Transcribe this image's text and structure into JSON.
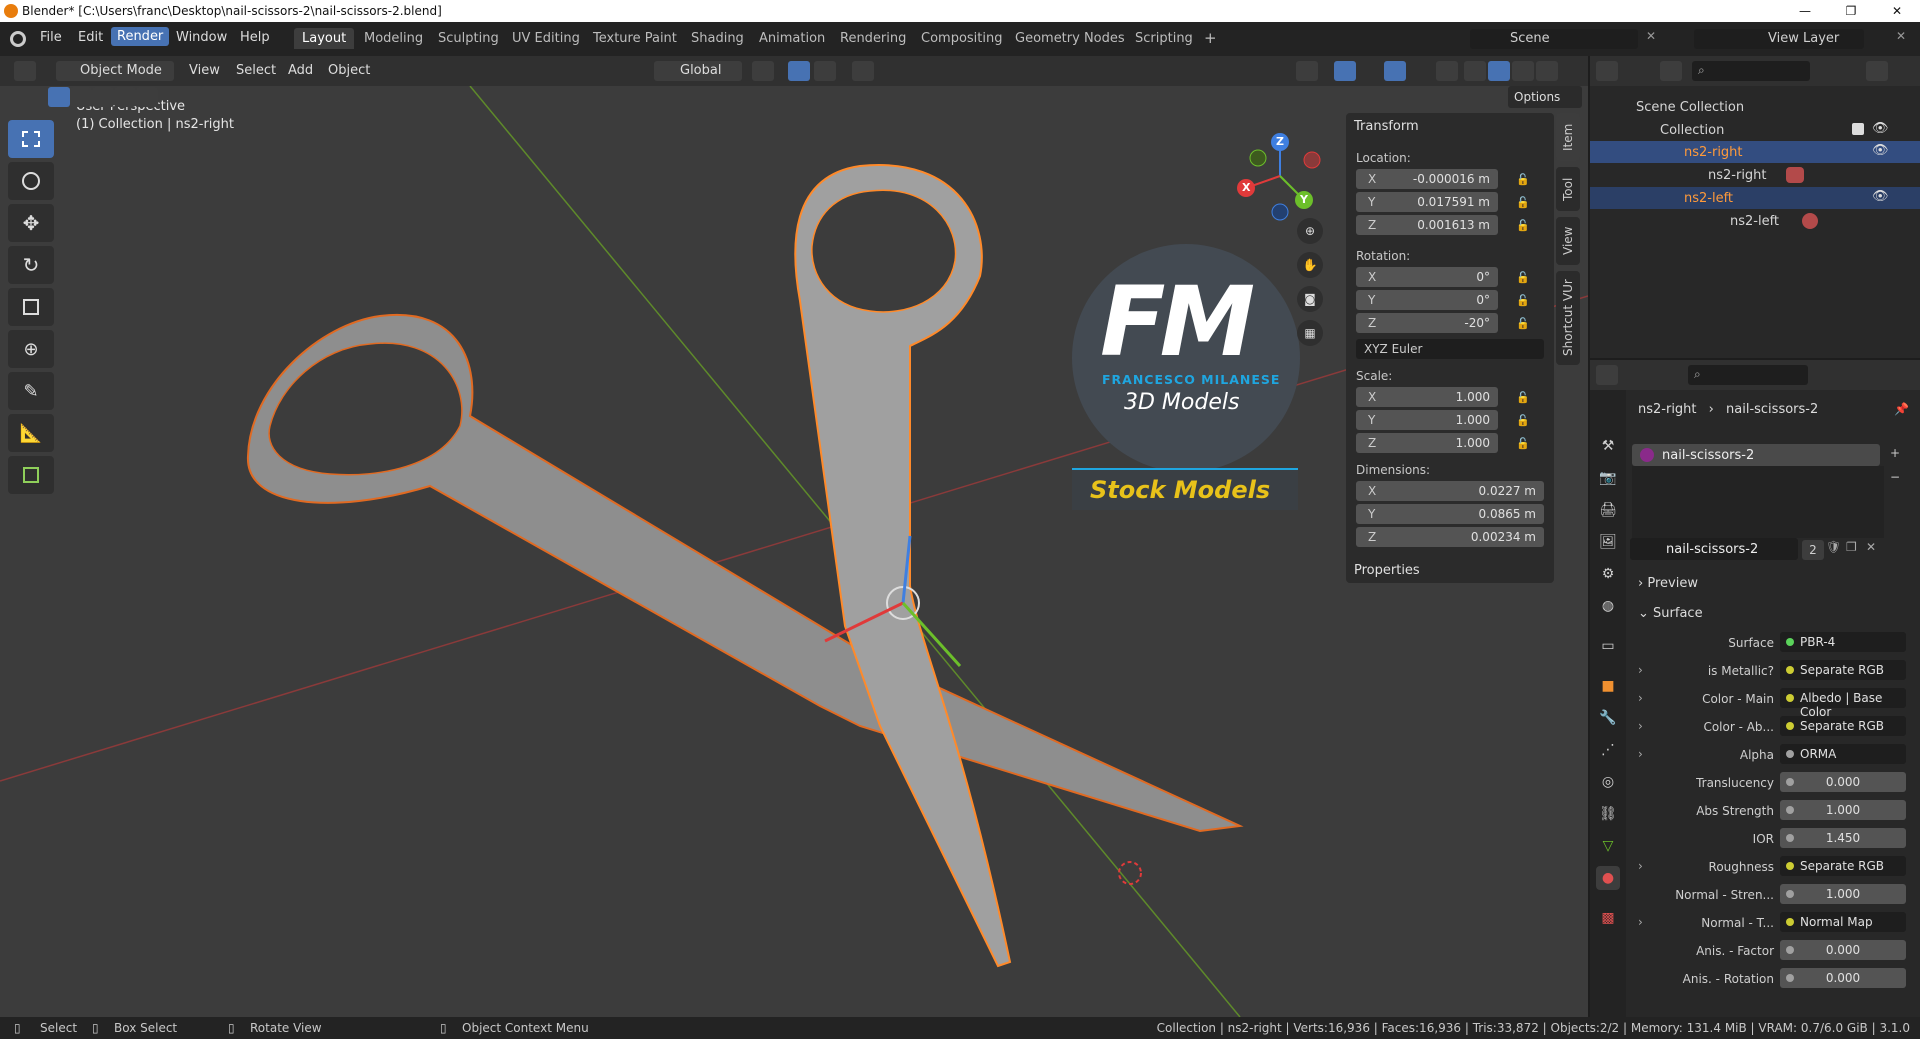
{
  "window": {
    "title": "Blender* [C:\\Users\\franc\\Desktop\\nail-scissors-2\\nail-scissors-2.blend]",
    "min": "—",
    "max": "❐",
    "close": "✕"
  },
  "menus": [
    "File",
    "Edit",
    "Render",
    "Window",
    "Help"
  ],
  "workspaces": [
    "Layout",
    "Modeling",
    "Sculpting",
    "UV Editing",
    "Texture Paint",
    "Shading",
    "Animation",
    "Rendering",
    "Compositing",
    "Geometry Nodes",
    "Scripting",
    "+"
  ],
  "scene": "Scene",
  "view_layer": "View Layer",
  "header": {
    "mode": "Object Mode",
    "view": "View",
    "select": "Select",
    "add": "Add",
    "object": "Object",
    "orientation": "Global",
    "options": "Options"
  },
  "viewport": {
    "perspective": "User Perspective",
    "collection_info": "(1) Collection | ns2-right"
  },
  "logo": {
    "initials": "FM",
    "name": "FRANCESCO MILANESE",
    "sub": "3D Models",
    "banner": "Stock Models"
  },
  "gizmo": {
    "x": "X",
    "y": "Y",
    "z": "Z"
  },
  "transform": {
    "title": "Transform",
    "location_label": "Location:",
    "location": [
      {
        "ax": "X",
        "v": "-0.000016 m"
      },
      {
        "ax": "Y",
        "v": "0.017591 m"
      },
      {
        "ax": "Z",
        "v": "0.001613 m"
      }
    ],
    "rotation_label": "Rotation:",
    "rotation": [
      {
        "ax": "X",
        "v": "0°"
      },
      {
        "ax": "Y",
        "v": "0°"
      },
      {
        "ax": "Z",
        "v": "-20°"
      }
    ],
    "rotation_mode": "XYZ Euler",
    "scale_label": "Scale:",
    "scale": [
      {
        "ax": "X",
        "v": "1.000"
      },
      {
        "ax": "Y",
        "v": "1.000"
      },
      {
        "ax": "Z",
        "v": "1.000"
      }
    ],
    "dimensions_label": "Dimensions:",
    "dimensions": [
      {
        "ax": "X",
        "v": "0.0227 m"
      },
      {
        "ax": "Y",
        "v": "0.0865 m"
      },
      {
        "ax": "Z",
        "v": "0.00234 m"
      }
    ],
    "properties": "Properties"
  },
  "sidetabs": [
    "Item",
    "Tool",
    "View",
    "Shortcut VUr"
  ],
  "outliner": {
    "scene_collection": "Scene Collection",
    "collection": "Collection",
    "items": [
      "ns2-right",
      "ns2-right",
      "ns2-left",
      "ns2-left"
    ]
  },
  "props": {
    "object": "ns2-right",
    "material_path": "nail-scissors-2",
    "slot": "nail-scissors-2",
    "material_name": "nail-scissors-2",
    "users": "2",
    "preview": "Preview",
    "surface_section": "Surface",
    "rows": [
      {
        "label": "Surface",
        "value": "PBR-4",
        "dot": "#5bd35b",
        "num": false,
        "arrow": false
      },
      {
        "label": "is Metallic?",
        "value": "Separate RGB",
        "dot": "#cccc33",
        "num": false,
        "arrow": true
      },
      {
        "label": "Color - Main",
        "value": "Albedo | Base Color",
        "dot": "#cccc33",
        "num": false,
        "arrow": true
      },
      {
        "label": "Color - Ab...",
        "value": "Separate RGB",
        "dot": "#cccc33",
        "num": false,
        "arrow": true
      },
      {
        "label": "Alpha",
        "value": "ORMA",
        "dot": "#a0a0a0",
        "num": false,
        "arrow": true
      },
      {
        "label": "Translucency",
        "value": "0.000",
        "dot": "#a0a0a0",
        "num": true,
        "arrow": false
      },
      {
        "label": "Abs Strength",
        "value": "1.000",
        "dot": "#a0a0a0",
        "num": true,
        "arrow": false
      },
      {
        "label": "IOR",
        "value": "1.450",
        "dot": "#a0a0a0",
        "num": true,
        "arrow": false
      },
      {
        "label": "Roughness",
        "value": "Separate RGB",
        "dot": "#cccc33",
        "num": false,
        "arrow": true
      },
      {
        "label": "Normal - Stren...",
        "value": "1.000",
        "dot": "#a0a0a0",
        "num": true,
        "arrow": false
      },
      {
        "label": "Normal - T...",
        "value": "Normal Map",
        "dot": "#cccc33",
        "num": false,
        "arrow": true
      },
      {
        "label": "Anis. - Factor",
        "value": "0.000",
        "dot": "#a0a0a0",
        "num": true,
        "arrow": false
      },
      {
        "label": "Anis. - Rotation",
        "value": "0.000",
        "dot": "#a0a0a0",
        "num": true,
        "arrow": false
      }
    ]
  },
  "status": {
    "select": "Select",
    "box_select": "Box Select",
    "rotate": "Rotate View",
    "context": "Object Context Menu",
    "stats": "Collection | ns2-right | Verts:16,936 | Faces:16,936 | Tris:33,872 | Objects:2/2 | Memory: 131.4 MiB | VRAM: 0.7/6.0 GiB | 3.1.0"
  },
  "colors": {
    "accent": "#4772b3",
    "selected_orange": "#ff8a2a",
    "logo_blue": "#1fa6e0",
    "banner_yellow": "#e8c21a"
  }
}
